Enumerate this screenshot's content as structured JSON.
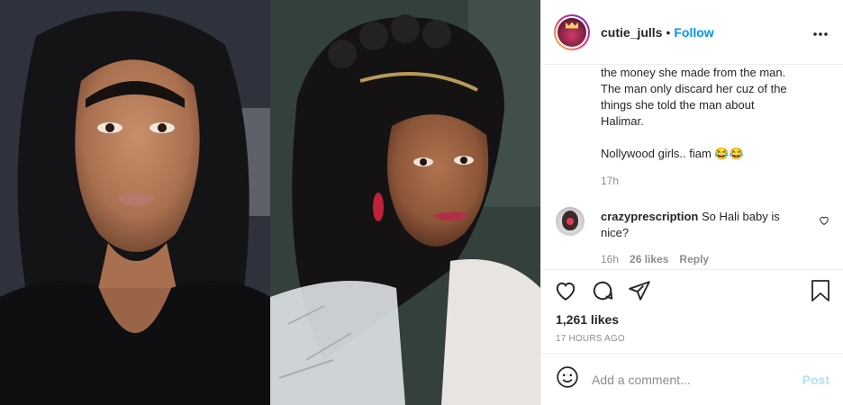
{
  "post": {
    "username": "cutie_julls",
    "separator": "•",
    "follow_label": "Follow",
    "more_label": "•••"
  },
  "images": {
    "left_alt": "photo-woman-black-dress",
    "right_alt": "photo-woman-braided-hair"
  },
  "caption": {
    "lines": [
      "the money she made from the man.",
      "The man only discard her cuz of the",
      "things she told the man about",
      "Halimar."
    ],
    "closing": "Nollywood girls.. fiam 😂😂",
    "time": "17h"
  },
  "comment": {
    "username": "crazyprescription",
    "text": "So Hali baby is nice?",
    "time": "16h",
    "likes": "26 likes",
    "reply_label": "Reply"
  },
  "actions": {
    "likes_count": "1,261 likes",
    "time_ago": "17 HOURS AGO"
  },
  "add_comment": {
    "placeholder": "Add a comment...",
    "post_label": "Post"
  },
  "colors": {
    "accent": "#0095f6",
    "post_disabled": "#b2dffc",
    "secondary_text": "#8e8e8e",
    "border": "#efefef"
  }
}
